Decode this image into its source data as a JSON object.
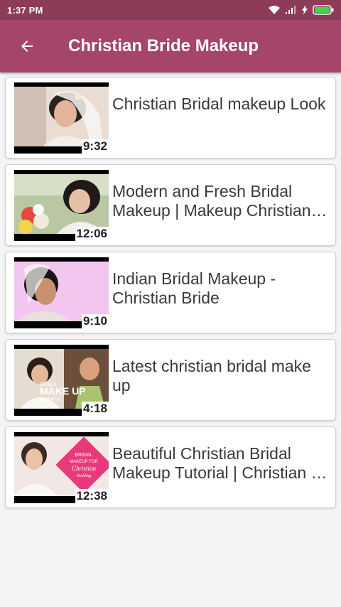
{
  "status": {
    "time": "1:37 PM"
  },
  "header": {
    "title": "Christian Bride Makeup"
  },
  "videos": [
    {
      "title": "Christian Bridal makeup Look",
      "duration": "9:32"
    },
    {
      "title": "Modern and Fresh Bridal Makeup | Makeup Christian…",
      "duration": "12:06"
    },
    {
      "title": "Indian Bridal Makeup - Christian Bride",
      "duration": "9:10"
    },
    {
      "title": "Latest christian bridal make up",
      "duration": "4:18"
    },
    {
      "title": "Beautiful Christian Bridal Makeup Tutorial | Christian …",
      "duration": "12:38"
    }
  ],
  "thumb_text": {
    "v4_line1": "BRIDAL",
    "v4_line2": "MAKE UP",
    "v4_line3": "AVINASH",
    "v5_line1": "BRIDAL",
    "v5_line2": "MAKEUP FOR",
    "v5_line3": "Christian",
    "v5_line4": "Wedding"
  },
  "colors": {
    "status_bar": "#8e3a59",
    "app_bar": "#a5456a"
  }
}
